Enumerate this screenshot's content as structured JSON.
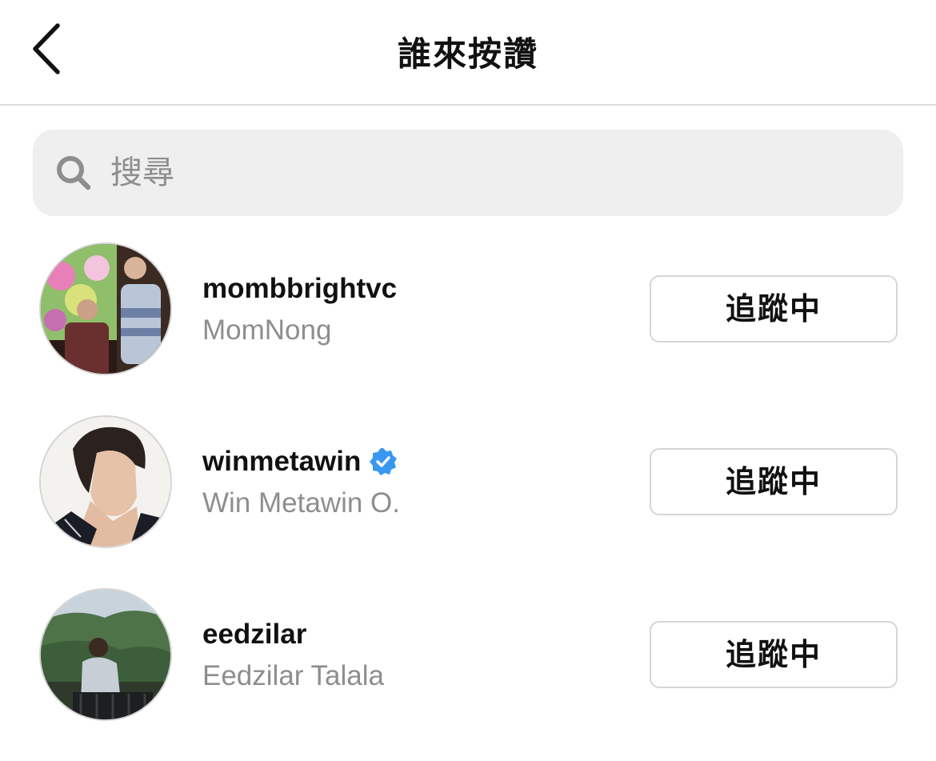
{
  "header": {
    "title": "誰來按讚",
    "back_icon": "chevron-left-icon"
  },
  "search": {
    "placeholder": "搜尋",
    "value": "",
    "icon": "search-icon"
  },
  "users": [
    {
      "username": "mombbrightvc",
      "full_name": "MomNong",
      "verified": false,
      "follow_label": "追蹤中"
    },
    {
      "username": "winmetawin",
      "full_name": "Win Metawin O.",
      "verified": true,
      "follow_label": "追蹤中"
    },
    {
      "username": "eedzilar",
      "full_name": "Eedzilar Talala",
      "verified": false,
      "follow_label": "追蹤中"
    }
  ],
  "colors": {
    "text_primary": "#111111",
    "text_secondary": "#8e8e8e",
    "search_bg": "#efefef",
    "verified_blue": "#3897f0",
    "border": "#d6d6d6"
  }
}
